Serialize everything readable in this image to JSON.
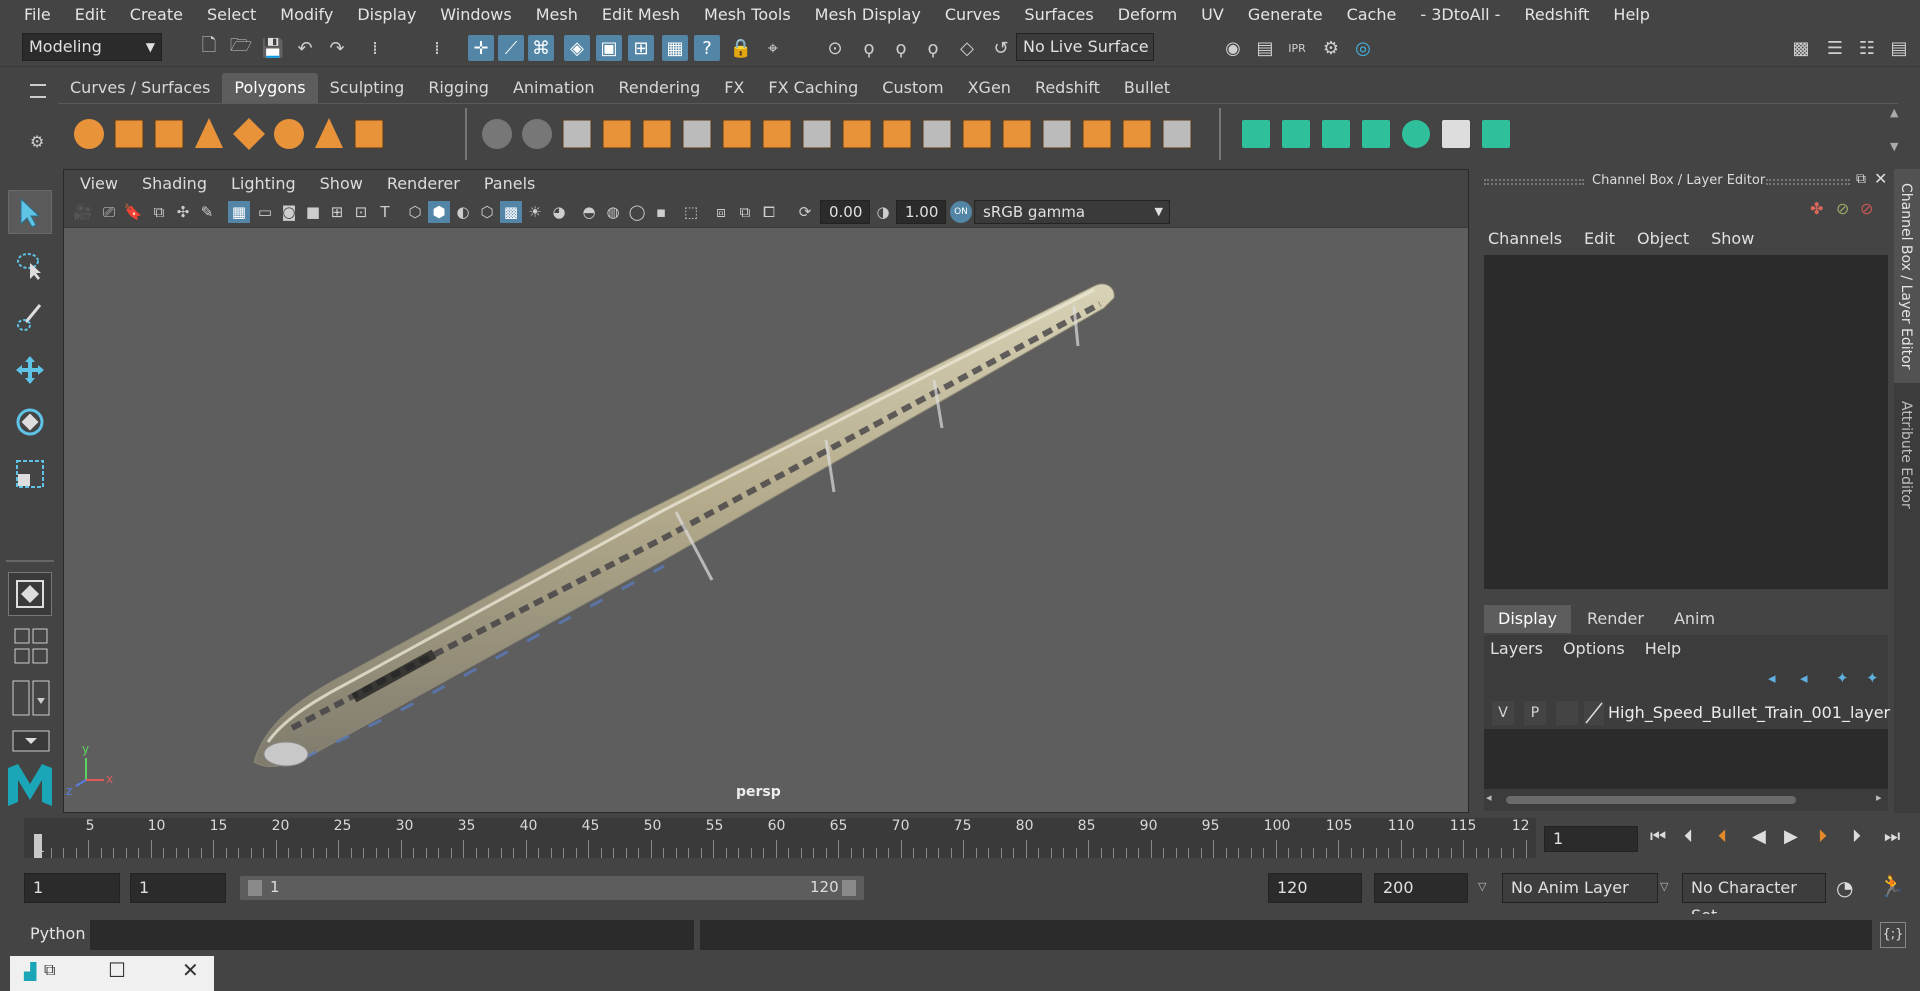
{
  "menubar": {
    "items": [
      "File",
      "Edit",
      "Create",
      "Select",
      "Modify",
      "Display",
      "Windows",
      "Mesh",
      "Edit Mesh",
      "Mesh Tools",
      "Mesh Display",
      "Curves",
      "Surfaces",
      "Deform",
      "UV",
      "Generate",
      "Cache",
      "- 3DtoAll -",
      "Redshift",
      "Help"
    ]
  },
  "status": {
    "mode": "Modeling",
    "live_surface": "No Live Surface"
  },
  "shelf": {
    "tabs": [
      "Curves / Surfaces",
      "Polygons",
      "Sculpting",
      "Rigging",
      "Animation",
      "Rendering",
      "FX",
      "FX Caching",
      "Custom",
      "XGen",
      "Redshift",
      "Bullet"
    ],
    "active_tab": "Polygons"
  },
  "viewport": {
    "menus": [
      "View",
      "Shading",
      "Lighting",
      "Show",
      "Renderer",
      "Panels"
    ],
    "exposure": "0.00",
    "gamma": "1.00",
    "color_space": "sRGB gamma",
    "camera_label": "persp",
    "axis_labels": {
      "y": "y",
      "x": "x",
      "z": "z"
    }
  },
  "channel_box": {
    "title": "Channel Box / Layer Editor",
    "menus": [
      "Channels",
      "Edit",
      "Object",
      "Show"
    ],
    "layer_tabs": [
      "Display",
      "Render",
      "Anim"
    ],
    "active_layer_tab": "Display",
    "layer_menus": [
      "Layers",
      "Options",
      "Help"
    ],
    "layer": {
      "v": "V",
      "p": "P",
      "name": "High_Speed_Bullet_Train_001_layer"
    }
  },
  "side_tabs": {
    "channel_box": "Channel Box / Layer Editor",
    "attribute_editor": "Attribute Editor"
  },
  "timeline": {
    "ticks": [
      "1",
      "5",
      "10",
      "15",
      "20",
      "25",
      "30",
      "35",
      "40",
      "45",
      "50",
      "55",
      "60",
      "65",
      "70",
      "75",
      "80",
      "85",
      "90",
      "95",
      "100",
      "105",
      "110",
      "115",
      "12"
    ],
    "current_frame": "1"
  },
  "range": {
    "start": "1",
    "playback_start": "1",
    "slider_start": "1",
    "slider_end": "120",
    "playback_end": "120",
    "end": "200",
    "anim_layer": "No Anim Layer",
    "character_set": "No Character Set"
  },
  "cmdline": {
    "language": "Python"
  },
  "colors": {
    "accent": "#5285a6",
    "shelf_orange": "#e8923a",
    "shelf_teal": "#2fbf9a",
    "viewport_bg": "#5e5e5e"
  }
}
